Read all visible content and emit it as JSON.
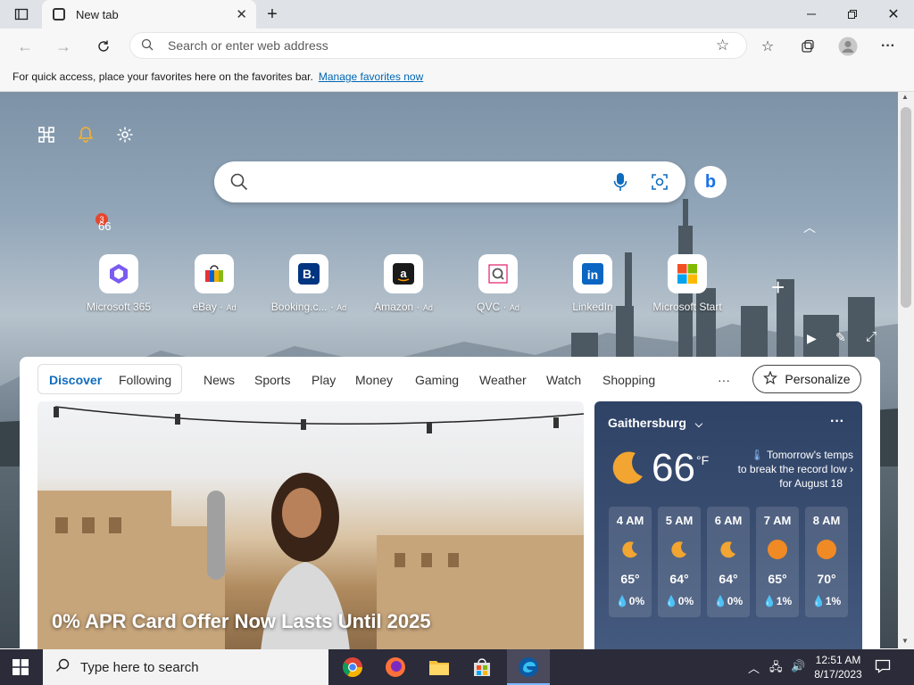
{
  "browser": {
    "tab_title": "New tab",
    "address_placeholder": "Search or enter web address"
  },
  "favorites_bar": {
    "message": "For quick access, place your favorites here on the favorites bar.",
    "link": "Manage favorites now"
  },
  "newtab": {
    "notification_count": "3",
    "mini_temp": "66"
  },
  "quick_links": [
    {
      "label": "Microsoft 365",
      "ad": ""
    },
    {
      "label": "eBay",
      "ad": "Ad"
    },
    {
      "label": "Booking.c...",
      "ad": "Ad"
    },
    {
      "label": "Amazon",
      "ad": "Ad"
    },
    {
      "label": "QVC",
      "ad": "Ad"
    },
    {
      "label": "LinkedIn",
      "ad": ""
    },
    {
      "label": "Microsoft Start",
      "ad": ""
    }
  ],
  "feed": {
    "tabs_seg": [
      "Discover",
      "Following"
    ],
    "tabs": [
      "News",
      "Sports",
      "Play",
      "Money",
      "Gaming",
      "Weather",
      "Watch",
      "Shopping"
    ],
    "more": "···",
    "personalize": "Personalize",
    "hero_title": "0% APR Card Offer Now Lasts Until 2025"
  },
  "weather": {
    "location": "Gaithersburg",
    "temp": "66",
    "unit": "°F",
    "alert_line1": "Tomorrow's temps",
    "alert_line2": "to break the record low",
    "alert_line3": "for August 18",
    "hours": [
      {
        "time": "4 AM",
        "temp": "65°",
        "precip": "0%",
        "icon": "moon-icon"
      },
      {
        "time": "5 AM",
        "temp": "64°",
        "precip": "0%",
        "icon": "moon-icon"
      },
      {
        "time": "6 AM",
        "temp": "64°",
        "precip": "0%",
        "icon": "moon-icon"
      },
      {
        "time": "7 AM",
        "temp": "65°",
        "precip": "1%",
        "icon": "sun-icon"
      },
      {
        "time": "8 AM",
        "temp": "70°",
        "precip": "1%",
        "icon": "sun-icon"
      }
    ]
  },
  "taskbar": {
    "search_placeholder": "Type here to search",
    "time": "12:51 AM",
    "date": "8/17/2023"
  },
  "colors": {
    "accent": "#0066b4",
    "feed_active": "#0f6cbd",
    "badge": "#e5462e"
  }
}
